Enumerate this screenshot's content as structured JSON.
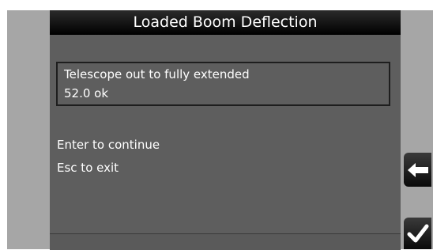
{
  "title": "Loaded Boom Deflection",
  "info": {
    "line1": "Telescope out to fully extended",
    "line2": "52.0 ok"
  },
  "prompts": {
    "enter": "Enter to continue",
    "esc": "Esc to exit"
  },
  "buttons": {
    "back_icon": "arrow-left-icon",
    "ok_icon": "checkmark-icon"
  }
}
